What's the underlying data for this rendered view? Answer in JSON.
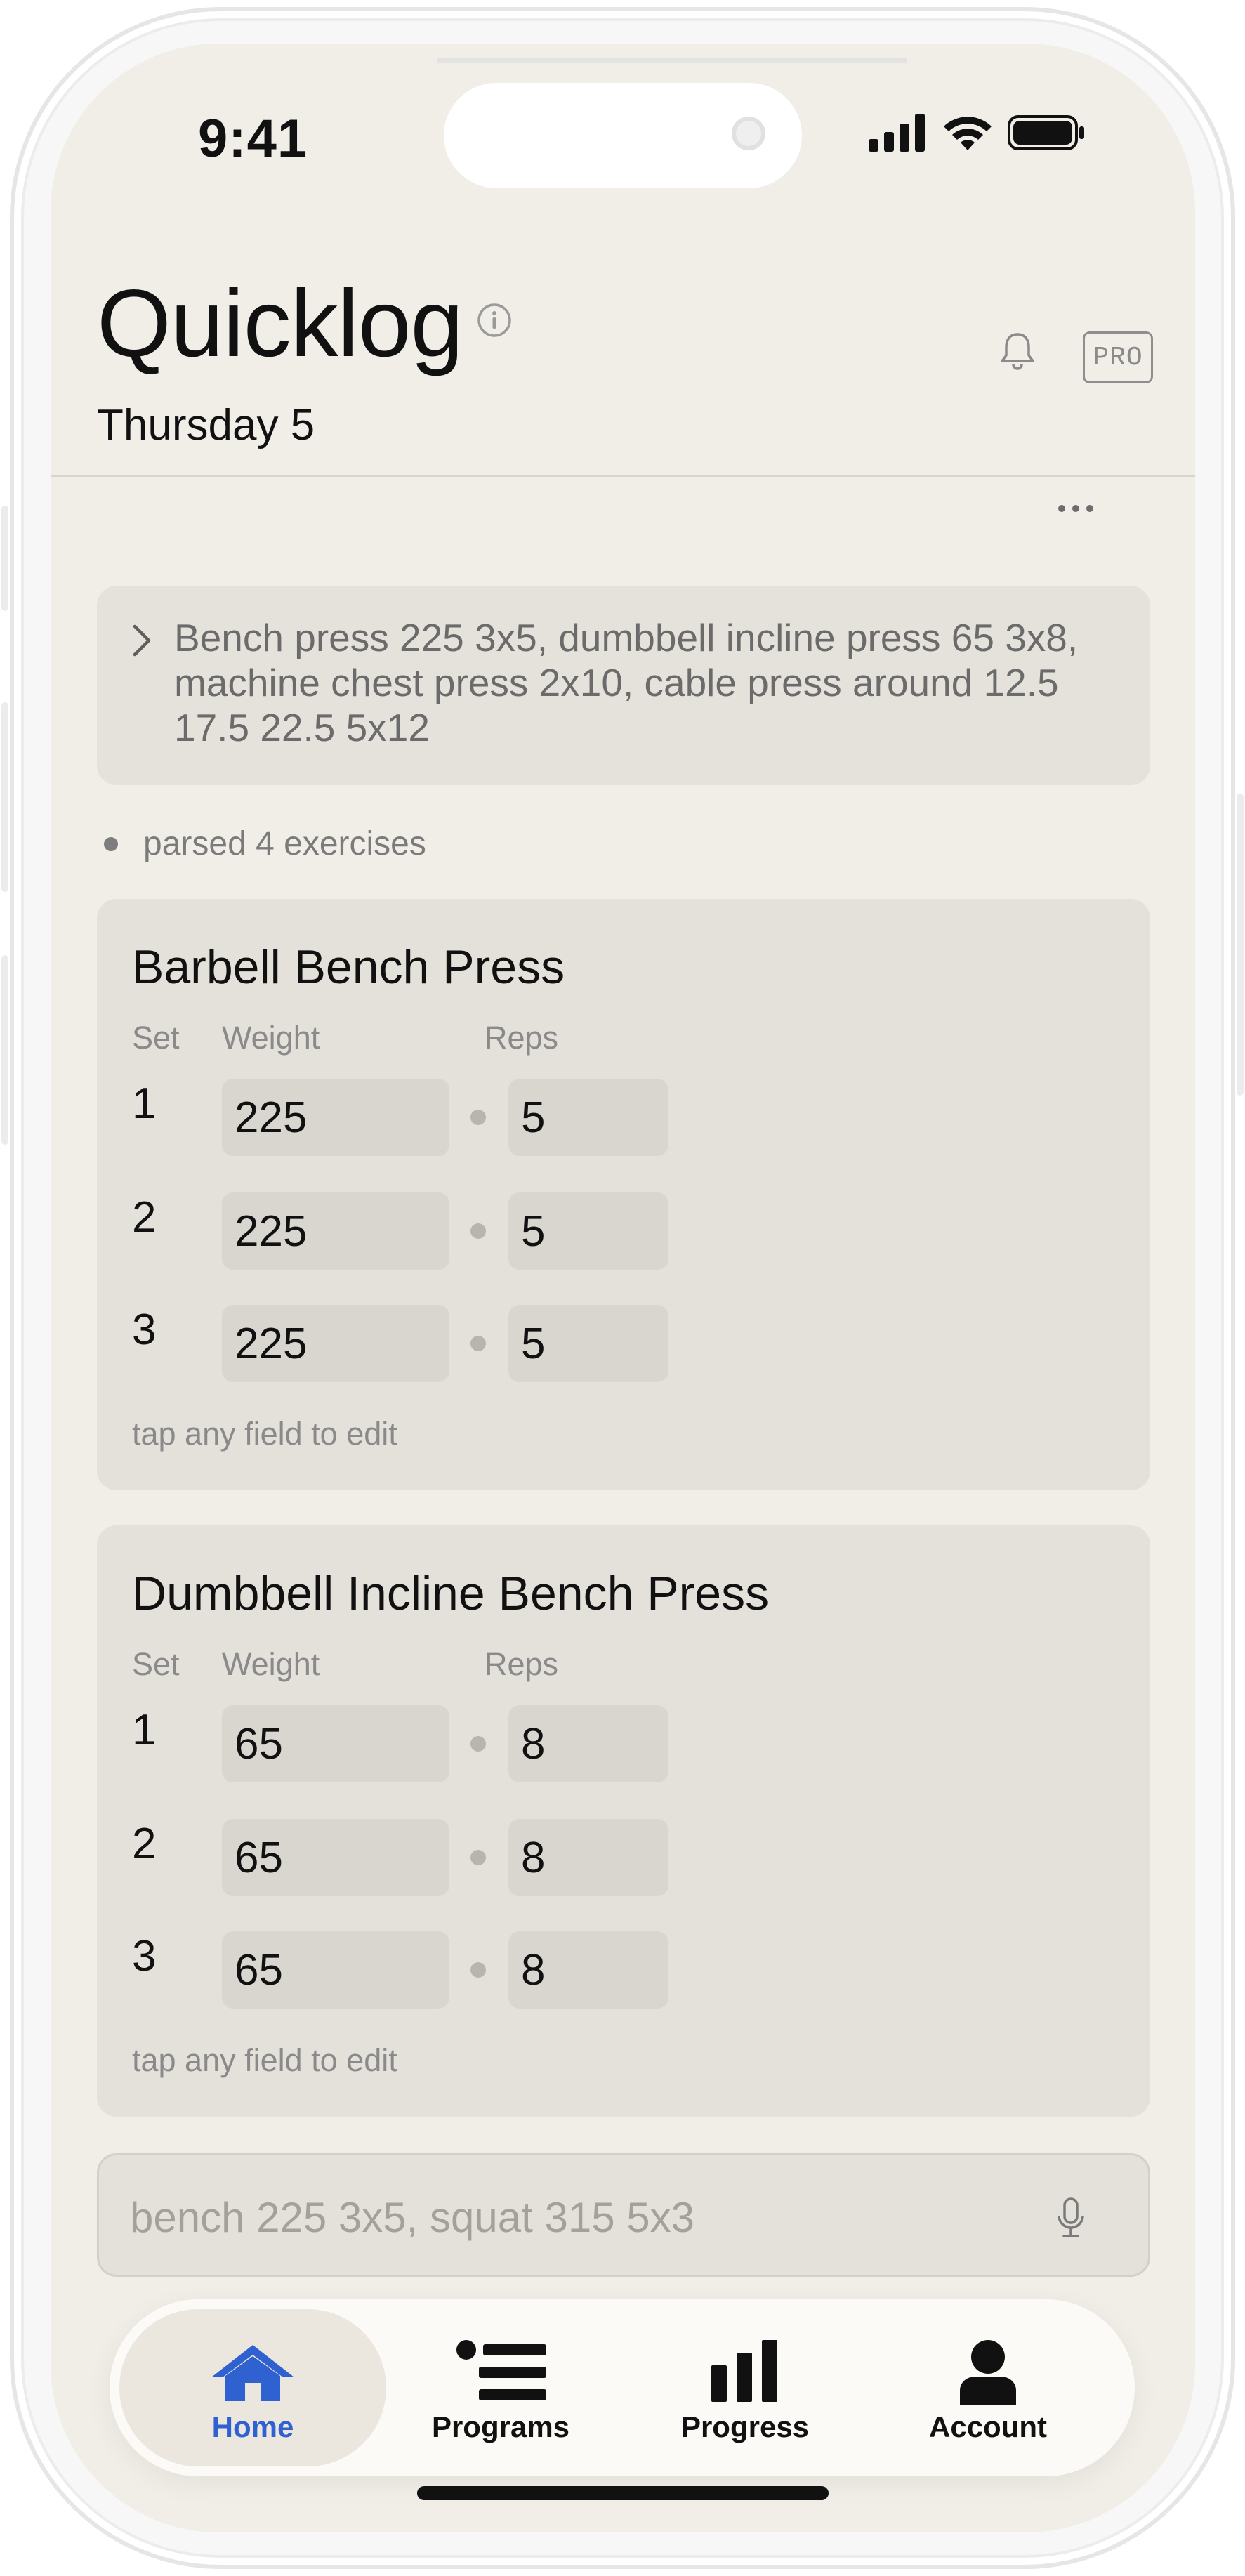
{
  "status_bar": {
    "time": "9:41",
    "icons": [
      "cellular-signal-icon",
      "wifi-icon",
      "battery-icon"
    ]
  },
  "header": {
    "title": "Quicklog",
    "date": "Thursday 5",
    "pro_badge": "PRO",
    "icons": [
      "info-icon",
      "bell-icon",
      "more-icon"
    ]
  },
  "prompt": {
    "text": "Bench press 225 3x5, dumbbell incline press 65 3x8, machine chest press 2x10, cable press around 12.5 17.5 22.5  5x12"
  },
  "parse_status": "parsed 4 exercises",
  "exercises": [
    {
      "name": "Barbell Bench Press",
      "headers": {
        "set": "Set",
        "weight": "Weight",
        "reps": "Reps"
      },
      "sets": [
        {
          "set": "1",
          "weight": "225",
          "reps": "5"
        },
        {
          "set": "2",
          "weight": "225",
          "reps": "5"
        },
        {
          "set": "3",
          "weight": "225",
          "reps": "5"
        }
      ],
      "hint": "tap any field to edit"
    },
    {
      "name": "Dumbbell Incline Bench Press",
      "headers": {
        "set": "Set",
        "weight": "Weight",
        "reps": "Reps"
      },
      "sets": [
        {
          "set": "1",
          "weight": "65",
          "reps": "8"
        },
        {
          "set": "2",
          "weight": "65",
          "reps": "8"
        },
        {
          "set": "3",
          "weight": "65",
          "reps": "8"
        }
      ],
      "hint": "tap any field to edit"
    }
  ],
  "input": {
    "value": "",
    "placeholder": "bench 225 3x5, squat 315 5x3"
  },
  "tabs": [
    {
      "label": "Home",
      "icon": "home-icon",
      "active": true
    },
    {
      "label": "Programs",
      "icon": "list-icon",
      "active": false
    },
    {
      "label": "Progress",
      "icon": "bar-chart-icon",
      "active": false
    },
    {
      "label": "Account",
      "icon": "person-icon",
      "active": false
    }
  ],
  "colors": {
    "background": "#f1eee8",
    "card": "#e4e0da",
    "field": "#d9d5cf",
    "accent": "#2f62d0",
    "text": "#111111",
    "muted": "#8a8a8a"
  }
}
